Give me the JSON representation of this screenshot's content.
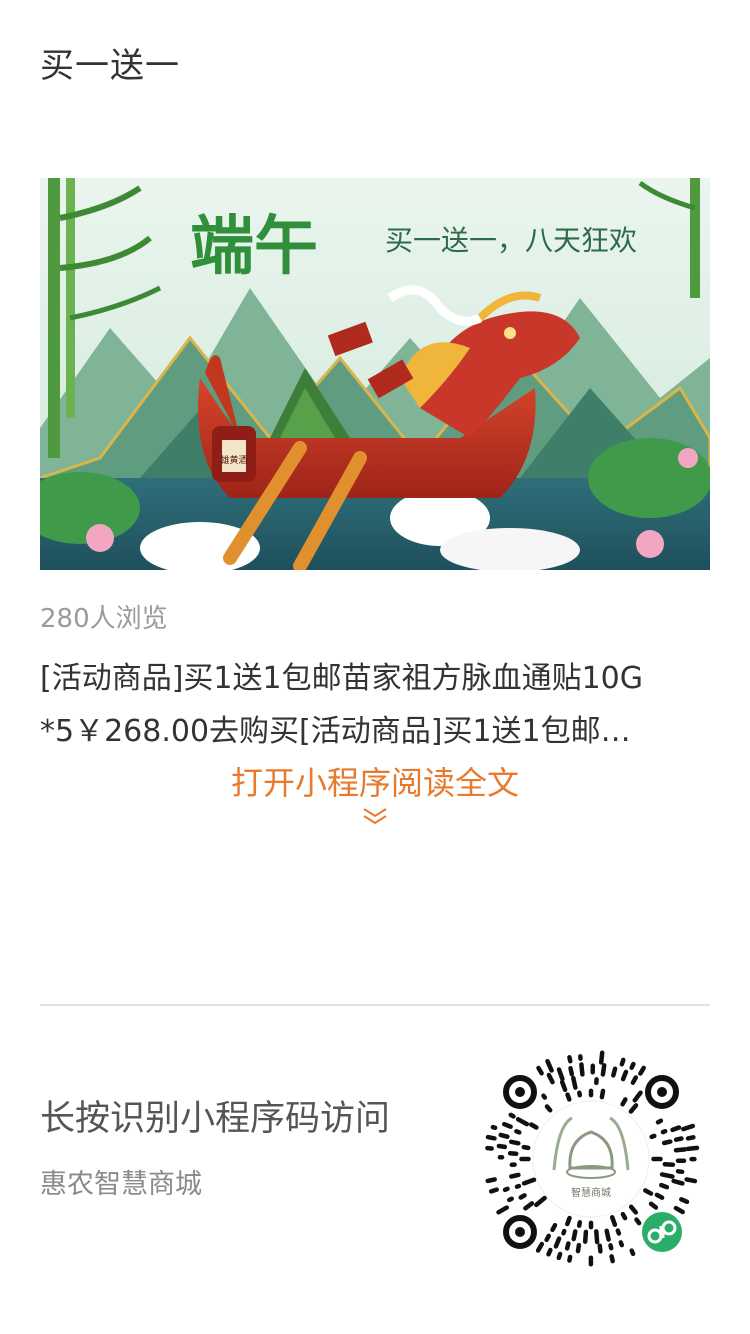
{
  "header": {
    "title": "买一送一"
  },
  "banner": {
    "heading": "端午",
    "tagline": "买一送一，八天狂欢",
    "jar_label": "雄黄酒"
  },
  "article": {
    "views": "280人浏览",
    "line1": "[活动商品]买1送1包邮苗家祖方脉血通贴10G",
    "line2": "*5￥268.00去购买[活动商品]买1送1包邮…",
    "open_link": "打开小程序阅读全文"
  },
  "footer": {
    "prompt": "长按识别小程序码访问",
    "mini_program_name": "惠农智慧商城",
    "qr_logo_text": "智慧商城"
  },
  "colors": {
    "accent": "#e8792d",
    "text_primary": "#333333",
    "text_secondary": "#9a9a9a",
    "mini_program_green": "#2aae67"
  },
  "icons": {
    "expand": "chevron-down-double-icon",
    "mini_program": "mini-program-icon"
  }
}
